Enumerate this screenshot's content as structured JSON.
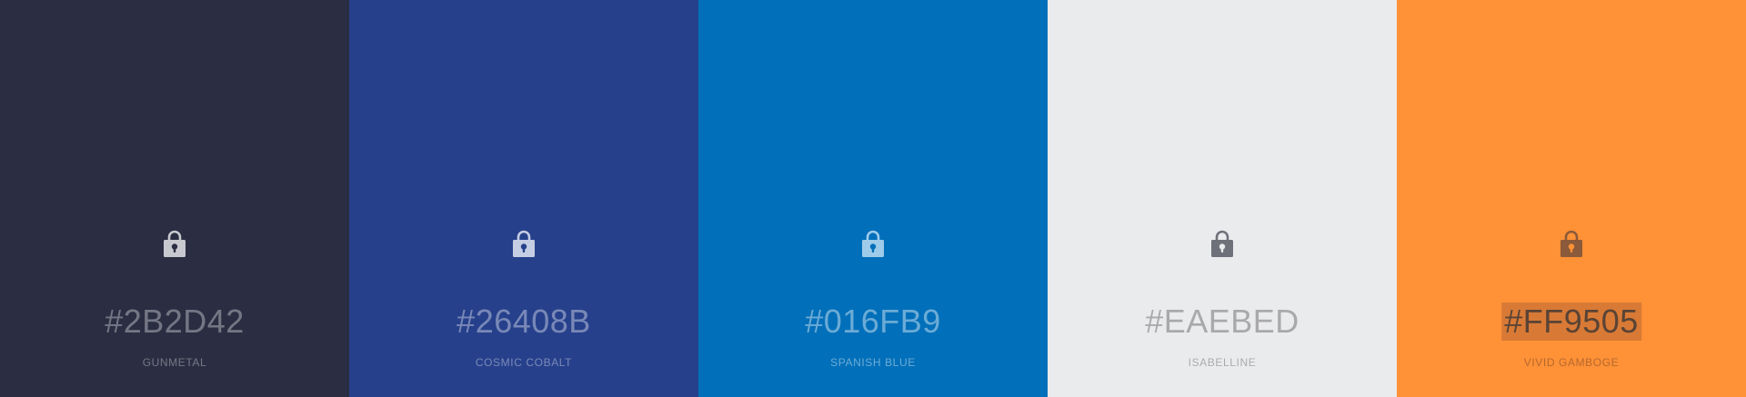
{
  "swatches": [
    {
      "hex": "#2B2D42",
      "name": "GUNMETAL",
      "background": "#2b2d42",
      "lock_icon": "lock-icon",
      "lock_color": "#c8c9cf",
      "keyhole_color": "#2b2d42"
    },
    {
      "hex": "#26408B",
      "name": "COSMIC COBALT",
      "background": "#26408b",
      "lock_icon": "lock-icon",
      "lock_color": "#c5cde4",
      "keyhole_color": "#26408b"
    },
    {
      "hex": "#016FB9",
      "name": "SPANISH BLUE",
      "background": "#016fb9",
      "lock_icon": "lock-icon",
      "lock_color": "#9fcbea",
      "keyhole_color": "#016fb9"
    },
    {
      "hex": "#EAEBED",
      "name": "ISABELLINE",
      "background": "#eaebed",
      "lock_icon": "lock-icon",
      "lock_color": "#6e7179",
      "keyhole_color": "#eaebed"
    },
    {
      "hex": "#FF9505",
      "name": "VIVID GAMBOGE",
      "background": "#ff9136",
      "lock_icon": "lock-icon",
      "lock_color": "#8a5a3a",
      "keyhole_color": "#ff9136"
    }
  ]
}
